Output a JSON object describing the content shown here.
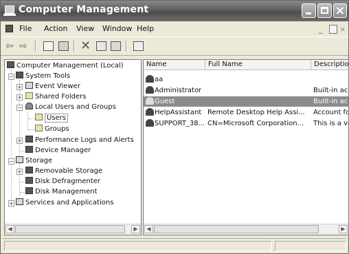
{
  "window": {
    "title": "Computer Management"
  },
  "menubar": {
    "items": [
      "File",
      "Action",
      "View",
      "Window",
      "Help"
    ]
  },
  "mdi_controls": {
    "min": "_",
    "max": "",
    "close": "×"
  },
  "toolbar": {
    "icons": [
      "back-arrow",
      "forward-arrow",
      "up-folder",
      "show-hide-tree",
      "delete",
      "properties",
      "export-list",
      "help"
    ]
  },
  "tree": {
    "items": [
      {
        "label": "Computer Management (Local)",
        "icon": "computer-management-icon"
      },
      {
        "label": "System Tools",
        "icon": "tools-icon"
      },
      {
        "label": "Event Viewer",
        "icon": "event-viewer-icon"
      },
      {
        "label": "Shared Folders",
        "icon": "shared-folder-icon"
      },
      {
        "label": "Local Users and Groups",
        "icon": "users-groups-icon"
      },
      {
        "label": "Users",
        "icon": "folder-icon"
      },
      {
        "label": "Groups",
        "icon": "folder-icon"
      },
      {
        "label": "Performance Logs and Alerts",
        "icon": "performance-icon"
      },
      {
        "label": "Device Manager",
        "icon": "device-manager-icon"
      },
      {
        "label": "Storage",
        "icon": "storage-icon"
      },
      {
        "label": "Removable Storage",
        "icon": "removable-storage-icon"
      },
      {
        "label": "Disk Defragmenter",
        "icon": "defragmenter-icon"
      },
      {
        "label": "Disk Management",
        "icon": "disk-management-icon"
      },
      {
        "label": "Services and Applications",
        "icon": "services-icon"
      }
    ],
    "selected": "Users"
  },
  "list": {
    "columns": [
      "Name",
      "Full Name",
      "Description"
    ],
    "rows": [
      {
        "name": "aa",
        "full_name": "",
        "description": ""
      },
      {
        "name": "Administrator",
        "full_name": "",
        "description": "Built-in acco"
      },
      {
        "name": "Guest",
        "full_name": "",
        "description": "Built-in acco"
      },
      {
        "name": "HelpAssistant",
        "full_name": "Remote Desktop Help Assi...",
        "description": "Account for"
      },
      {
        "name": "SUPPORT_38...",
        "full_name": "CN=Microsoft Corporation...",
        "description": "This is a ve"
      }
    ],
    "selected_row": "Guest"
  }
}
